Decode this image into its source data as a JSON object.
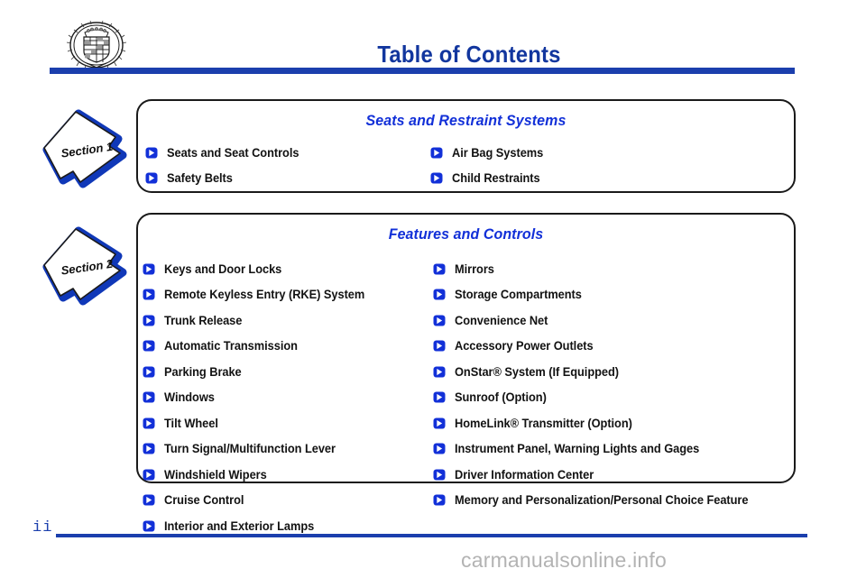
{
  "header": {
    "logo_name": "cadillac-crest-logo",
    "title": "Table of Contents",
    "rule_color": "#1b3fad",
    "title_color": "#12369e"
  },
  "sections": [
    {
      "badge": "Section 1",
      "heading": "Seats and Restraint Systems",
      "columns": [
        {
          "items": [
            "Seats and Seat Controls",
            "Safety Belts"
          ]
        },
        {
          "items": [
            "Air Bag Systems",
            "Child Restraints"
          ]
        }
      ]
    },
    {
      "badge": "Section 2",
      "heading": "Features and Controls",
      "columns": [
        {
          "items": [
            "Keys and Door Locks",
            "Remote Keyless Entry (RKE) System",
            "Trunk Release",
            "Automatic Transmission",
            "Parking Brake",
            "Windows",
            "Tilt Wheel",
            "Turn Signal/Multifunction Lever",
            "Windshield Wipers",
            "Cruise Control",
            "Interior and Exterior Lamps"
          ]
        },
        {
          "items": [
            "Mirrors",
            "Storage Compartments",
            "Convenience Net",
            "Accessory Power Outlets",
            "OnStar® System (If Equipped)",
            "Sunroof (Option)",
            "HomeLink® Transmitter (Option)",
            "Instrument Panel, Warning Lights and Gages",
            "Driver Information Center",
            "Memory and Personalization/Personal Choice Feature"
          ]
        }
      ]
    }
  ],
  "footer": {
    "page_number": "ii",
    "watermark": "carmanualsonline.info"
  },
  "icons": {
    "bullet": "triangle-right-icon"
  },
  "colors": {
    "blue_rule": "#1b3fad",
    "blue_heading": "#1230d8",
    "badge_blue": "#1038b8",
    "text": "#121212",
    "watermark_gray": "#b3b3b3"
  }
}
